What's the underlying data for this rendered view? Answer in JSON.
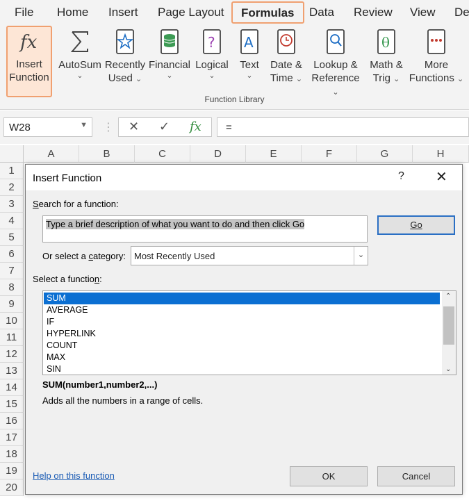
{
  "menu": {
    "tabs": [
      {
        "label": "File"
      },
      {
        "label": "Home"
      },
      {
        "label": "Insert"
      },
      {
        "label": "Page Layout"
      },
      {
        "label": "Formulas"
      },
      {
        "label": "Data"
      },
      {
        "label": "Review"
      },
      {
        "label": "View"
      },
      {
        "label": "De"
      }
    ],
    "active": "Formulas"
  },
  "ribbon": {
    "group_label": "Function Library",
    "buttons": [
      {
        "line1": "Insert",
        "line2": "Function",
        "icon": "fx-icon"
      },
      {
        "line1": "AutoSum",
        "line2": "",
        "icon": "sigma-icon"
      },
      {
        "line1": "Recently",
        "line2": "Used",
        "icon": "star-book-icon"
      },
      {
        "line1": "Financial",
        "line2": "",
        "icon": "coins-book-icon"
      },
      {
        "line1": "Logical",
        "line2": "",
        "icon": "question-book-icon"
      },
      {
        "line1": "Text",
        "line2": "",
        "icon": "text-book-icon"
      },
      {
        "line1": "Date &",
        "line2": "Time",
        "icon": "clock-book-icon"
      },
      {
        "line1": "Lookup &",
        "line2": "Reference",
        "icon": "magnifier-book-icon"
      },
      {
        "line1": "Math &",
        "line2": "Trig",
        "icon": "theta-book-icon"
      },
      {
        "line1": "More",
        "line2": "Functions",
        "icon": "dots-book-icon"
      }
    ]
  },
  "formula_bar": {
    "name_box": "W28",
    "cancel_glyph": "✕",
    "enter_glyph": "✓",
    "fx_glyph": "fx",
    "formula": "="
  },
  "grid": {
    "columns": [
      "A",
      "B",
      "C",
      "D",
      "E",
      "F",
      "G",
      "H"
    ],
    "rows": [
      "1",
      "2",
      "3",
      "4",
      "5",
      "6",
      "7",
      "8",
      "9",
      "10",
      "11",
      "12",
      "13",
      "14",
      "15",
      "16",
      "17",
      "18",
      "19",
      "20"
    ]
  },
  "dialog": {
    "title": "Insert Function",
    "help_glyph": "?",
    "close_glyph": "✕",
    "search_label_key": "S",
    "search_label_rest": "earch for a function:",
    "search_text": "Type a brief description of what you want to do and then click Go",
    "go_label": "Go",
    "category_label_pre": "Or select a ",
    "category_label_key": "c",
    "category_label_post": "ategory:",
    "category_value": "Most Recently Used",
    "function_label_pre": "Select a functio",
    "function_label_key": "n",
    "function_label_post": ":",
    "functions": [
      "SUM",
      "AVERAGE",
      "IF",
      "HYPERLINK",
      "COUNT",
      "MAX",
      "SIN"
    ],
    "selected_function": "SUM",
    "syntax": "SUM(number1,number2,...)",
    "description": "Adds all the numbers in a range of cells.",
    "help_link": "Help on this function",
    "ok_label": "OK",
    "cancel_label": "Cancel"
  },
  "colors": {
    "accent_highlight": "#f0a070",
    "selection_blue": "#0b6fd2",
    "link_blue": "#1a5bb4"
  }
}
